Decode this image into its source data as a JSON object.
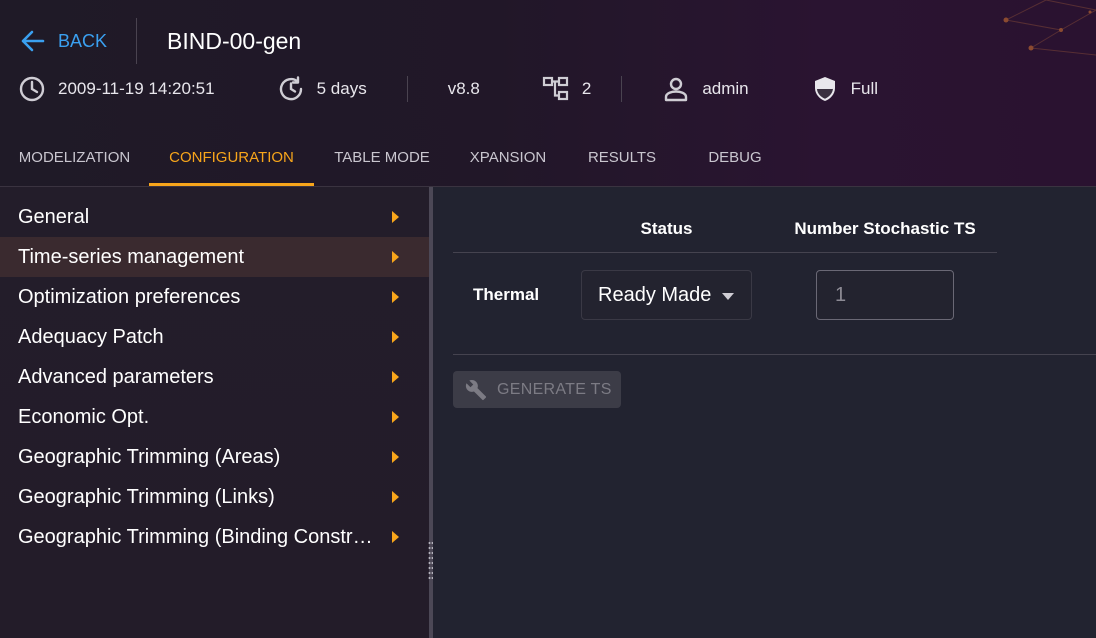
{
  "header": {
    "back_label": "BACK",
    "study_name": "BIND-00-gen",
    "info": {
      "date": "2009-11-19 14:20:51",
      "age": "5 days",
      "version": "v8.8",
      "variants_count": "2",
      "owner": "admin",
      "permission": "Full"
    }
  },
  "tabs": [
    {
      "label": "MODELIZATION"
    },
    {
      "label": "CONFIGURATION",
      "active": true
    },
    {
      "label": "TABLE MODE"
    },
    {
      "label": "XPANSION"
    },
    {
      "label": "RESULTS"
    },
    {
      "label": "DEBUG"
    }
  ],
  "sidebar": {
    "items": [
      {
        "label": "General"
      },
      {
        "label": "Time-series management",
        "selected": true
      },
      {
        "label": "Optimization preferences"
      },
      {
        "label": "Adequacy Patch"
      },
      {
        "label": "Advanced parameters"
      },
      {
        "label": "Economic Opt."
      },
      {
        "label": "Geographic Trimming (Areas)"
      },
      {
        "label": "Geographic Trimming (Links)"
      },
      {
        "label": "Geographic Trimming (Binding Constraints)"
      }
    ]
  },
  "timeseries": {
    "columns": {
      "status": "Status",
      "number": "Number Stochastic TS"
    },
    "rows": [
      {
        "label": "Thermal",
        "status": "Ready Made",
        "number": "1"
      }
    ],
    "generate_button": "GENERATE TS"
  },
  "colors": {
    "accent": "#f7a51b",
    "link": "#3aa0f0",
    "selected_row": "#3a2a2f"
  },
  "icons": {
    "back": "arrow-left-icon",
    "date": "clock-icon",
    "age": "history-icon",
    "variants": "account-tree-icon",
    "owner": "person-icon",
    "permission": "shield-icon",
    "menu_arrow": "caret-right-icon",
    "select": "caret-down-icon",
    "generate": "wrench-icon"
  }
}
